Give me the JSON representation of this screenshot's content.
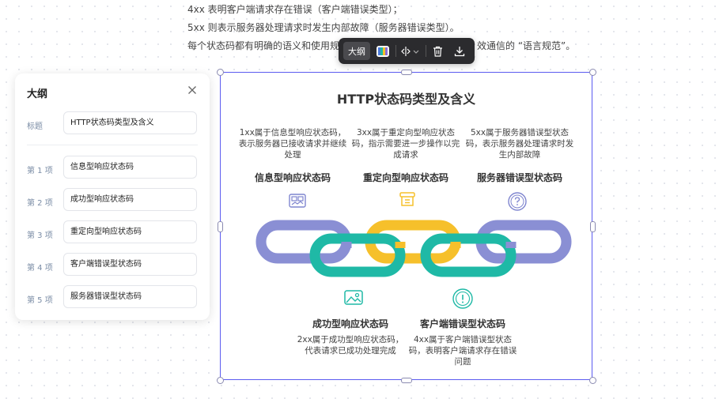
{
  "document": {
    "lines": [
      "4xx 表明客户端请求存在错误（客户端错误类型）；",
      "5xx 则表示服务器处理请求时发生内部故障（服务器错误类型）。",
      "每个状态码都有明确的语义和使用规",
      "效通信的 “语言规范”。"
    ]
  },
  "toolbar": {
    "outline_label": "大纲",
    "icons": [
      "palette-icon",
      "mirror-icon",
      "chevron-down-icon",
      "trash-icon",
      "download-icon"
    ]
  },
  "outline_panel": {
    "title": "大纲",
    "title_label": "标题",
    "title_value": "HTTP状态码类型及含义",
    "items": [
      {
        "label": "第 1 项",
        "value": "信息型响应状态码"
      },
      {
        "label": "第 2 项",
        "value": "成功型响应状态码"
      },
      {
        "label": "第 3 项",
        "value": "重定向型响应状态码"
      },
      {
        "label": "第 4 项",
        "value": "客户端错误型状态码"
      },
      {
        "label": "第 5 项",
        "value": "服务器错误型状态码"
      }
    ]
  },
  "infographic": {
    "title": "HTTP状态码类型及含义",
    "top": [
      {
        "desc": "1xx属于信息型响应状态码，表示服务器已接收请求并继续处理",
        "name": "信息型响应状态码",
        "icon": "image-grid-icon",
        "color": "#7f85cf"
      },
      {
        "desc": "3xx属于重定向型响应状态码，指示需要进一步操作以完成请求",
        "name": "重定向型响应状态码",
        "icon": "box-icon",
        "color": "#f6c02b"
      },
      {
        "desc": "5xx属于服务器错误型状态码，表示服务器处理请求时发生内部故障",
        "name": "服务器错误型状态码",
        "icon": "question-icon",
        "color": "#7f85cf"
      }
    ],
    "bottom": [
      {
        "name": "成功型响应状态码",
        "desc": "2xx属于成功型响应状态码，代表请求已成功处理完成",
        "icon": "picture-icon",
        "color": "#1fb9a6"
      },
      {
        "name": "客户端错误型状态码",
        "desc": "4xx属于客户端错误型状态码，表明客户端请求存在错误问题",
        "icon": "warning-icon",
        "color": "#1fb9a6"
      }
    ]
  }
}
